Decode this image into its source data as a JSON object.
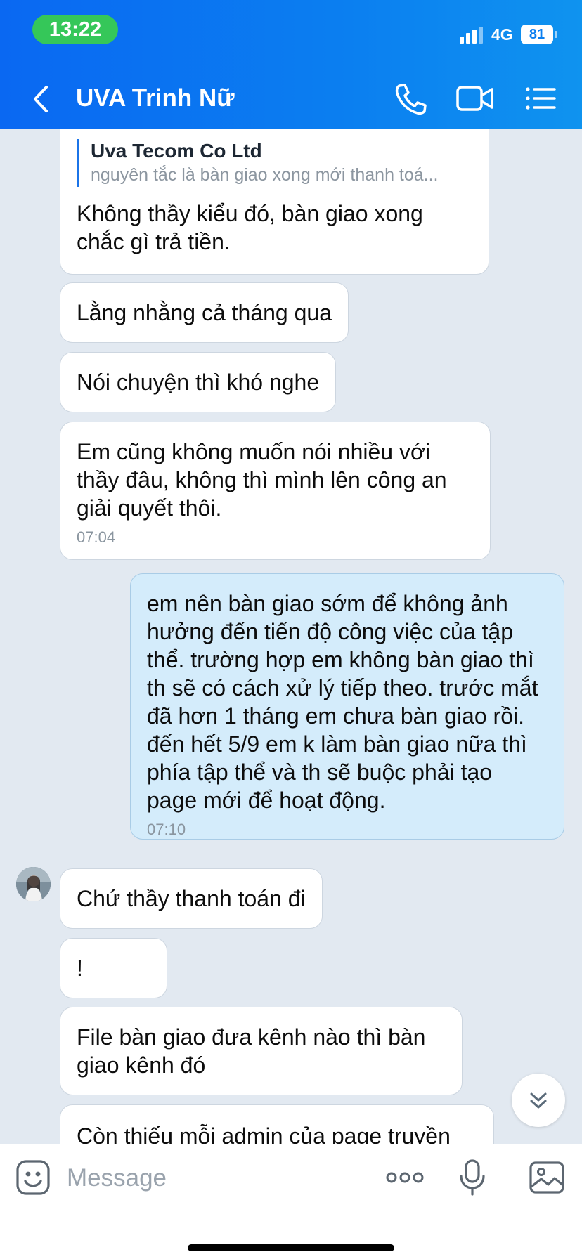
{
  "status_bar": {
    "time": "13:22",
    "network": "4G",
    "battery": "81"
  },
  "header": {
    "title": "UVA Trinh Nữ"
  },
  "messages": [
    {
      "quote_name": "Uva Tecom Co Ltd",
      "quote_text": "nguyên tắc là bàn giao xong mới thanh toá...",
      "text": "Không thầy kiểu đó, bàn giao xong chắc gì trả tiền."
    },
    {
      "text": "Lằng nhằng cả tháng qua"
    },
    {
      "text": "Nói chuyện thì khó nghe"
    },
    {
      "text": "Em cũng không muốn nói nhiều với thầy đâu, không thì mình lên công an giải quyết thôi.",
      "time": "07:04"
    },
    {
      "text": "em nên bàn giao sớm để không ảnh hưởng đến tiến độ công việc của tập thể. trường hợp em không bàn giao thì th sẽ có cách xử lý tiếp theo. trước mắt đã hơn 1 tháng em chưa bàn giao rồi. đến hết 5/9 em k làm bàn giao nữa thì phía tập thể và th sẽ buộc phải tạo page mới để hoạt động.",
      "time": "07:10"
    },
    {
      "text": "Chứ thầy thanh toán đi"
    },
    {
      "text": "!"
    },
    {
      "text": "File bàn giao đưa kênh nào thì bàn giao kênh đó"
    },
    {
      "text": "Còn thiếu mỗi admin của page truyền"
    }
  ],
  "input": {
    "placeholder": "Message"
  },
  "icons": {
    "back": "chevron-left-icon",
    "call": "phone-icon",
    "video": "video-camera-icon",
    "menu": "list-icon",
    "emoji": "emoji-icon",
    "more": "more-dots-icon",
    "mic": "microphone-icon",
    "image": "image-icon",
    "scroll": "double-chevron-down-icon"
  },
  "colors": {
    "header": "#0b7ff0",
    "outgoing_bubble": "#d4ecfb",
    "incoming_bubble": "#ffffff",
    "background": "#e2e9f1"
  }
}
